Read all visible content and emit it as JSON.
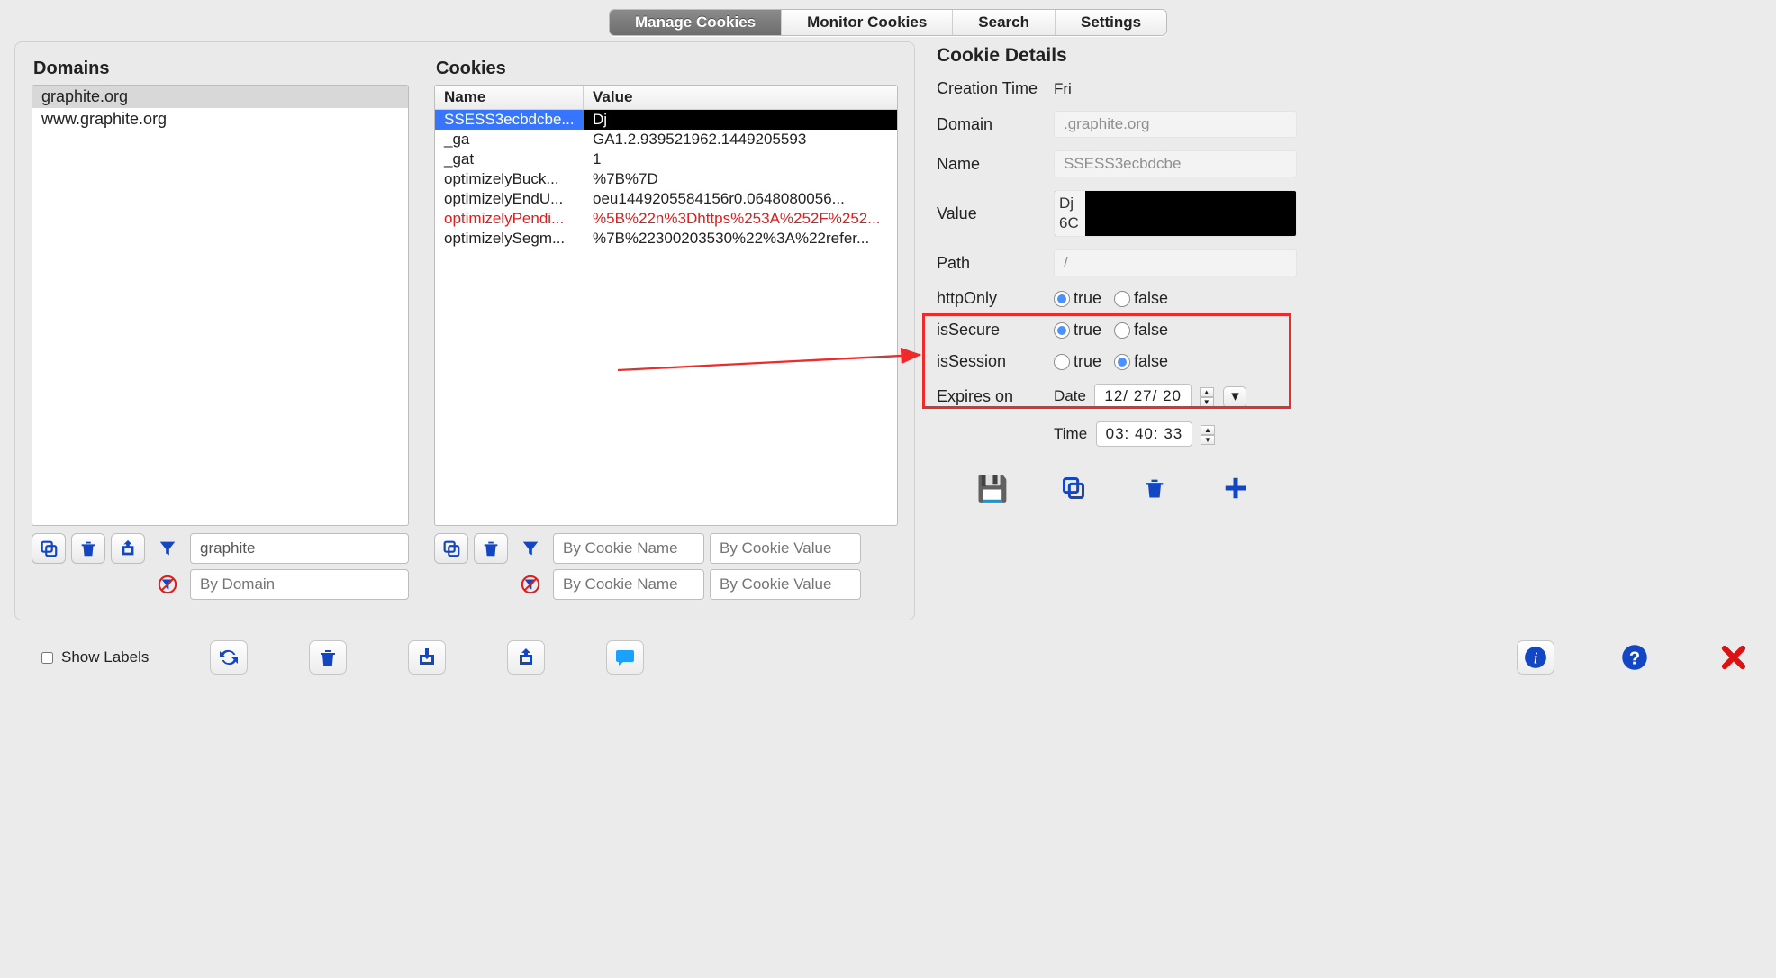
{
  "tabs": [
    "Manage Cookies",
    "Monitor Cookies",
    "Search",
    "Settings"
  ],
  "active_tab_index": 0,
  "domains_title": "Domains",
  "cookies_title": "Cookies",
  "domain_list": [
    {
      "name": "graphite.org",
      "selected": true
    },
    {
      "name": "www.graphite.org",
      "selected": false
    }
  ],
  "cookie_headers": {
    "name": "Name",
    "value": "Value"
  },
  "cookie_rows": [
    {
      "name": "SSESS3ecbdcbe...",
      "value": "Dj",
      "selected": true,
      "red": false
    },
    {
      "name": "_ga",
      "value": "GA1.2.939521962.1449205593",
      "selected": false,
      "red": false
    },
    {
      "name": "_gat",
      "value": "1",
      "selected": false,
      "red": false
    },
    {
      "name": "optimizelyBuck...",
      "value": "%7B%7D",
      "selected": false,
      "red": false
    },
    {
      "name": "optimizelyEndU...",
      "value": "oeu1449205584156r0.0648080056...",
      "selected": false,
      "red": false
    },
    {
      "name": "optimizelyPendi...",
      "value": "%5B%22n%3Dhttps%253A%252F%252...",
      "selected": false,
      "red": true
    },
    {
      "name": "optimizelySegm...",
      "value": "%7B%22300203530%22%3A%22refer...",
      "selected": false,
      "red": false
    }
  ],
  "domain_filter_value": "graphite",
  "domain_filter2_placeholder": "By Domain",
  "cookie_filter_name_placeholder": "By Cookie Name",
  "cookie_filter_value_placeholder": "By Cookie Value",
  "cookie_filter2_name_placeholder": "By Cookie Name",
  "cookie_filter2_value_placeholder": "By Cookie Value",
  "details": {
    "title": "Cookie Details",
    "creation_time_label": "Creation Time",
    "creation_time_value": "Fri",
    "domain_label": "Domain",
    "domain_value": ".graphite.org",
    "name_label": "Name",
    "name_value": "SSESS3ecbdcbe",
    "value_label": "Value",
    "value_value_left": "Dj\n6C",
    "path_label": "Path",
    "path_value": "/",
    "httpOnly_label": "httpOnly",
    "isSecure_label": "isSecure",
    "isSession_label": "isSession",
    "radio_true": "true",
    "radio_false": "false",
    "httpOnly": true,
    "isSecure": true,
    "isSession": false,
    "expires_label": "Expires on",
    "date_label": "Date",
    "date_value": "12/ 27/  20",
    "time_label": "Time",
    "time_value": "03: 40: 33"
  },
  "show_labels_text": "Show Labels"
}
